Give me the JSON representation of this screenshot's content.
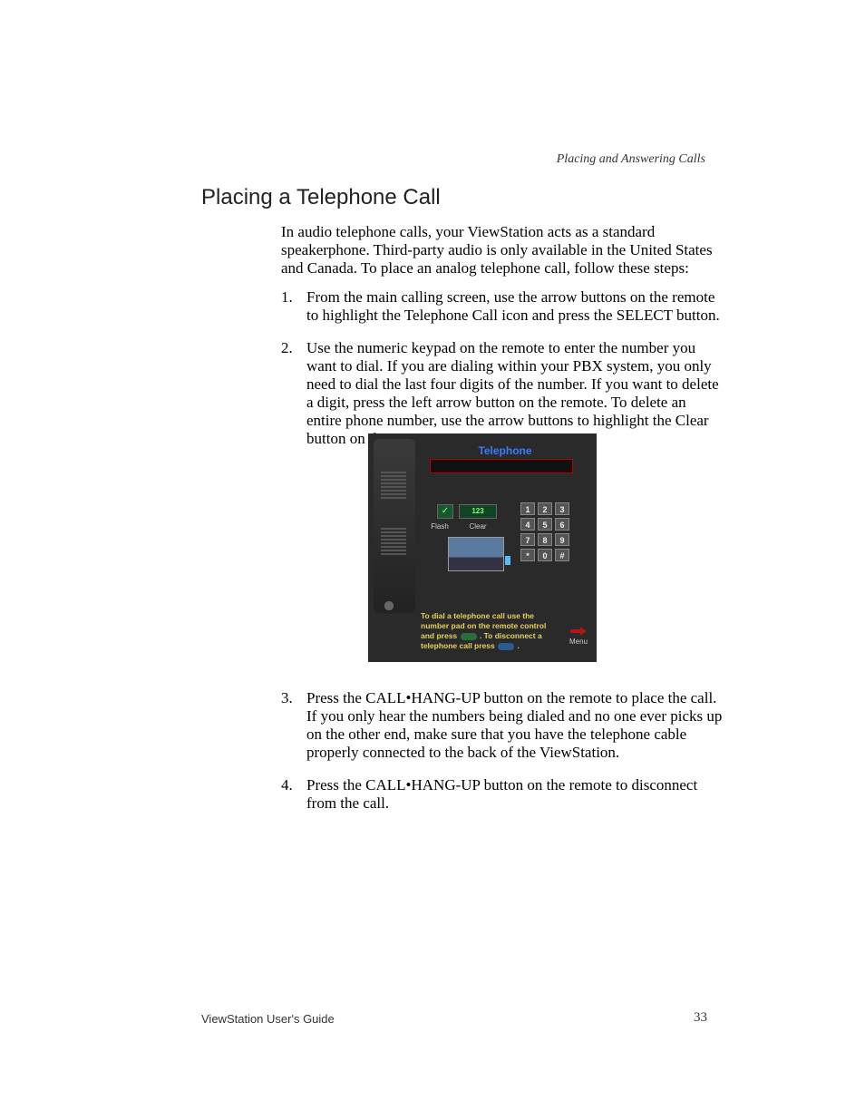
{
  "header": {
    "chapter": "Placing and Answering Calls"
  },
  "section_title": "Placing a Telephone Call",
  "intro": "In audio telephone calls, your ViewStation acts as a standard speakerphone. Third-party audio is only available in the United States and Canada. To place an analog telephone call, follow these steps:",
  "steps_a": [
    {
      "num": "1.",
      "text": "From the main calling screen, use the arrow buttons on the remote to highlight the Telephone Call icon and press the SELECT button."
    },
    {
      "num": "2.",
      "text": "Use the numeric keypad on the remote to enter the number you want to dial. If you are dialing within your PBX system, you only need to dial the last four digits of the number. If you want to delete a digit, press the left arrow button on the remote. To delete an entire phone number, use the arrow buttons to highlight the Clear button on the screen."
    }
  ],
  "screenshot": {
    "title": "Telephone",
    "field_value": "123",
    "check": "✓",
    "flash": "Flash",
    "clear": "Clear",
    "keys": [
      "1",
      "2",
      "3",
      "4",
      "5",
      "6",
      "7",
      "8",
      "9",
      "*",
      "0",
      "#"
    ],
    "instr_line1": "To dial a telephone call use the",
    "instr_line2": "number pad on the remote control",
    "instr_line3a": "and press ",
    "instr_line3b": " .  To disconnect a",
    "instr_line4a": "telephone call press ",
    "instr_line4b": " .",
    "menu": "Menu"
  },
  "steps_b": [
    {
      "num": "3.",
      "text": "Press the CALL•HANG-UP button on the remote to place the call. If you only hear the numbers being dialed and no one ever picks up on the other end, make sure that you have the telephone cable properly connected to the back of the ViewStation."
    },
    {
      "num": "4.",
      "text": "Press the CALL•HANG-UP button on the remote to disconnect from the call."
    }
  ],
  "footer": {
    "guide": "ViewStation User's Guide",
    "page": "33"
  }
}
